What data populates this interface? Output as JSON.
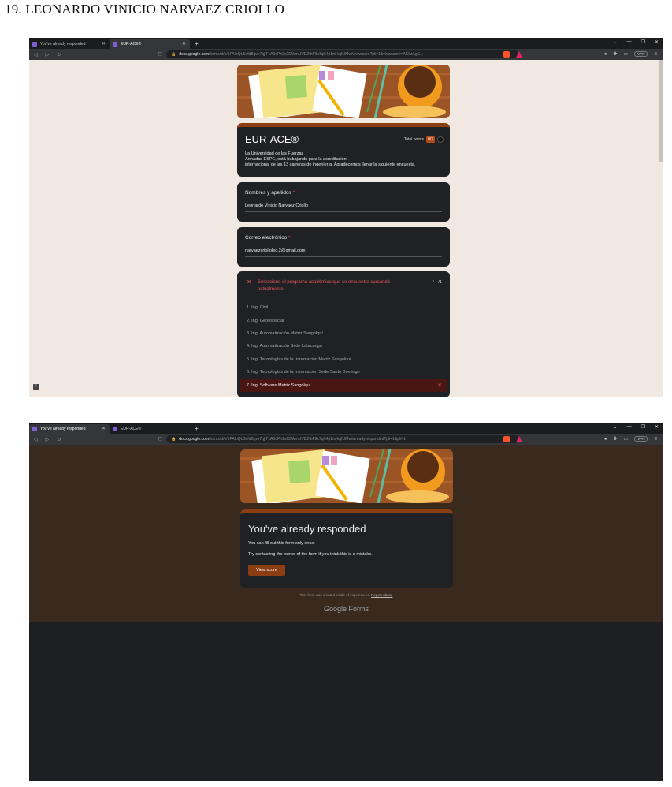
{
  "heading": "19. LEONARDO VINICIO NARVAEZ CRIOLLO",
  "browser1": {
    "tabs": [
      {
        "label": "You've already responded",
        "active": false
      },
      {
        "label": "EUR-ACE®",
        "active": true
      }
    ],
    "url_host": "docs.google.com",
    "url_path": "/forms/d/e/1FAIpQLScfdBgvx7qjiT1A0oPh2x2DWmUVDZfhF9x7qK4p1m-kqfUMw/viewscore?pli=1&viewscore=AE0zAgC...",
    "vpn_label": "VPN"
  },
  "browser2": {
    "tabs": [
      {
        "label": "You've already responded",
        "active": true
      },
      {
        "label": "EUR-ACE®",
        "active": false
      }
    ],
    "url_host": "docs.google.com",
    "url_path": "/forms/d/e/1FAIpQLScfdBgvx7qjiT1A0oPh2x2DWmUVDZfhF9x7qK4p1m-kqfUMw/alreadyresponded?pli=1&pli=1",
    "vpn_label": "VPN"
  },
  "form": {
    "title": "EUR-ACE®",
    "total_points_label": "Total points",
    "total_points_value": "0/7",
    "description_lines": [
      "La Universidad de las Fuerzas",
      "Armadas ESPE, está trabajando para la acreditación",
      "internacional de las 13 carreras de ingeniería. Agradecemos llenar la siguiente encuesta."
    ],
    "name_field": {
      "label": "Nombres y apellidos",
      "required_mark": "*",
      "value": "Leonardo Vinicio Narvaez Criollo"
    },
    "email_field": {
      "label": "Correo electrónico",
      "required_mark": "*",
      "value": "narvaezcriolloleo.2@gmail.com"
    },
    "question": {
      "text_line1": "Seleccione el programa académico que se encuentra cursando",
      "text_line2": "actualmente",
      "score": "*—/1",
      "options": [
        "1. Ing. Civil",
        "2. Ing. Geoespacial",
        "3. Ing. Automatización Matriz Sangolquí",
        "4. Ing. Automatización Sede Latacunga",
        "5. Ing. Tecnologías de la Información Matriz Sangolquí",
        "6. Ing. Tecnologías de la Información Sede Santo Domingo",
        "7. Ing. Software Matriz Sangolquí"
      ],
      "selected_index": 6
    }
  },
  "response_page": {
    "title": "You've already responded",
    "line1": "You can fill out this form only once.",
    "line2": "Try contacting the owner of the form if you think this is a mistake.",
    "button": "View score",
    "footer_text": "This form was created inside of espe.edu.ec.",
    "footer_link": "Report Abuse",
    "brand": "Google Forms"
  },
  "colors": {
    "accent": "#8b3e12",
    "error": "#e05757",
    "card_bg": "#202124",
    "page_bg_light": "#f1e8e1",
    "page_bg_brown": "#3a2a1e"
  }
}
